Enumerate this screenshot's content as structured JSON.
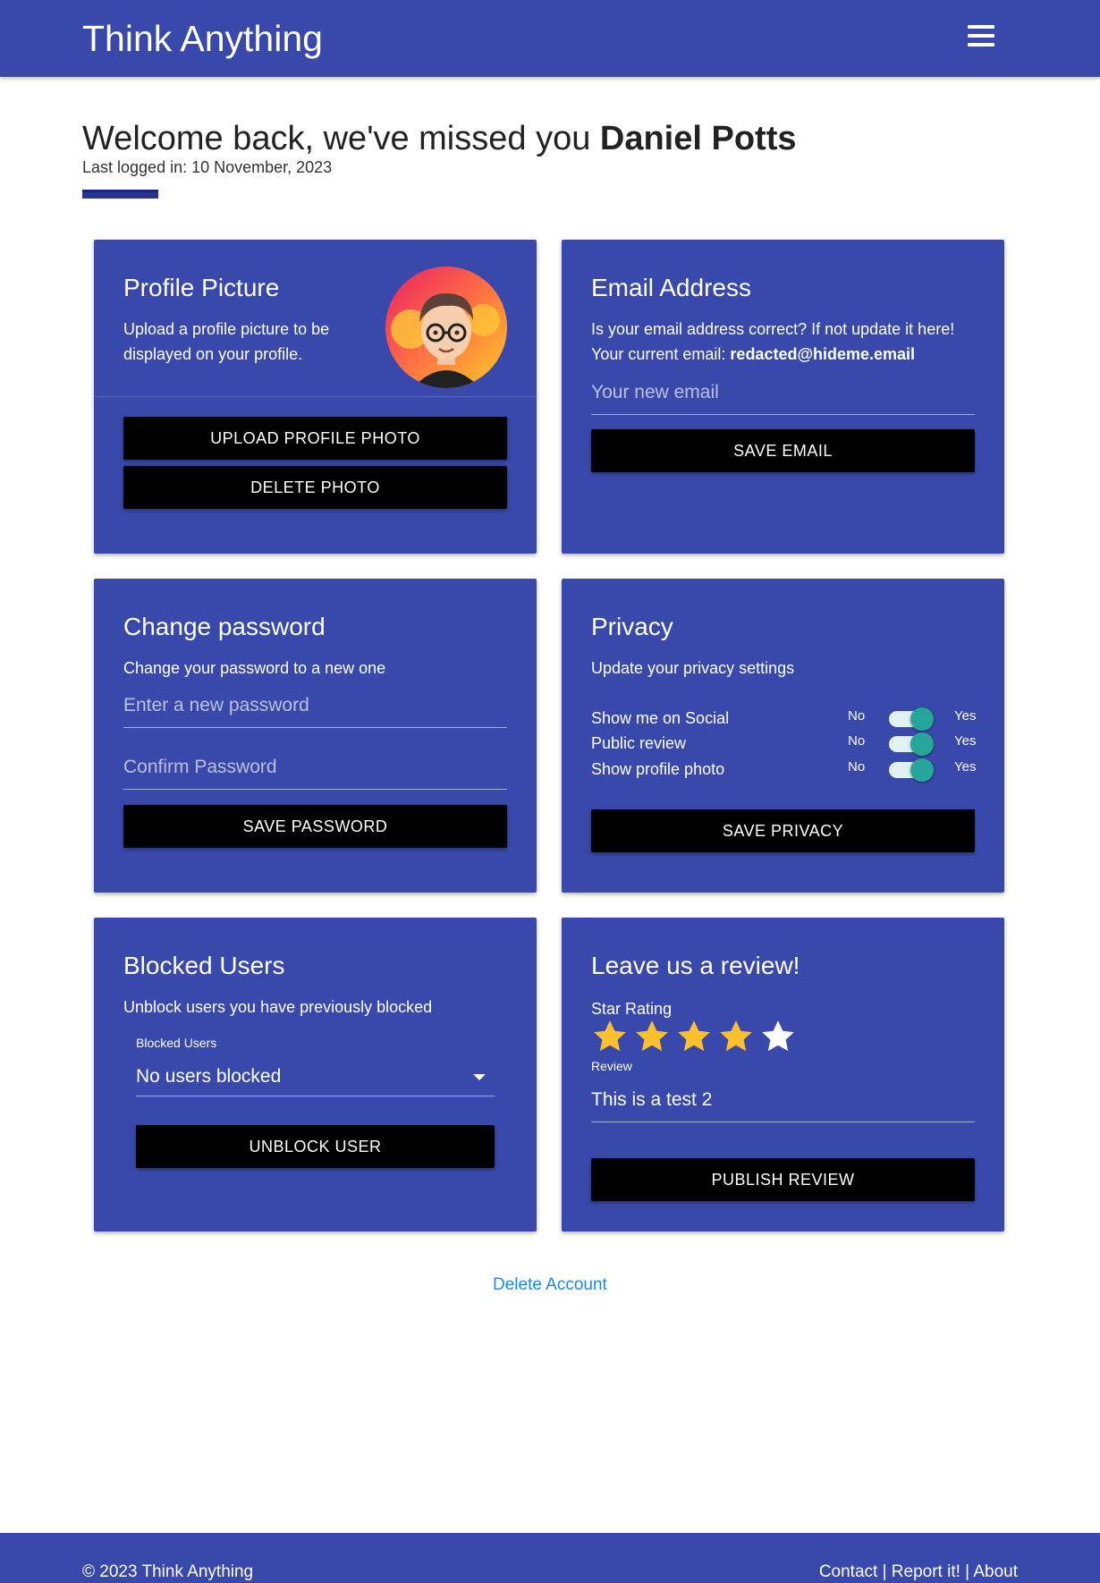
{
  "header": {
    "brand": "Think Anything",
    "menu_icon": "hamburger-menu-icon"
  },
  "welcome": {
    "greeting": "Welcome back, we've missed you ",
    "user_name": "Daniel Potts",
    "last_logged": "Last logged in: 10 November, 2023"
  },
  "profile_picture": {
    "title": "Profile Picture",
    "description": "Upload a profile picture to be displayed on your profile.",
    "upload_label": "UPLOAD PROFILE PHOTO",
    "delete_label": "DELETE PHOTO",
    "avatar_icon": "avatar-image"
  },
  "email": {
    "title": "Email Address",
    "description": "Is your email address correct? If not update it here!",
    "current_prefix": "Your current email: ",
    "current_email": "redacted@hideme.email",
    "placeholder": "Your new email",
    "save_label": "SAVE EMAIL"
  },
  "password": {
    "title": "Change password",
    "description": "Change your password to a new one",
    "new_placeholder": "Enter a new password",
    "confirm_placeholder": "Confirm Password",
    "save_label": "SAVE PASSWORD"
  },
  "privacy": {
    "title": "Privacy",
    "description": "Update your privacy settings",
    "off_label": "No",
    "on_label": "Yes",
    "settings": [
      {
        "label": "Show me on Social",
        "enabled": true
      },
      {
        "label": "Public review",
        "enabled": true
      },
      {
        "label": "Show profile photo",
        "enabled": true
      }
    ],
    "save_label": "SAVE PRIVACY"
  },
  "blocked": {
    "title": "Blocked Users",
    "description": "Unblock users you have previously blocked",
    "select_label": "Blocked Users",
    "selected": "No users blocked",
    "unblock_label": "UNBLOCK USER"
  },
  "review": {
    "title": "Leave us a review!",
    "rating_label": "Star Rating",
    "rating": 4,
    "max_rating": 5,
    "review_label": "Review",
    "review_text": "This is a test 2",
    "publish_label": "PUBLISH REVIEW",
    "star_color": "#fbc02d"
  },
  "delete_account": "Delete Account",
  "footer": {
    "copyright": "© 2023 Think Anything",
    "links": [
      "Contact",
      "Report it!",
      "About"
    ],
    "separator": "|"
  },
  "colors": {
    "primary": "#3949ab",
    "button": "#000000",
    "switch_knob": "#26a69a",
    "link": "#1e88e5"
  }
}
